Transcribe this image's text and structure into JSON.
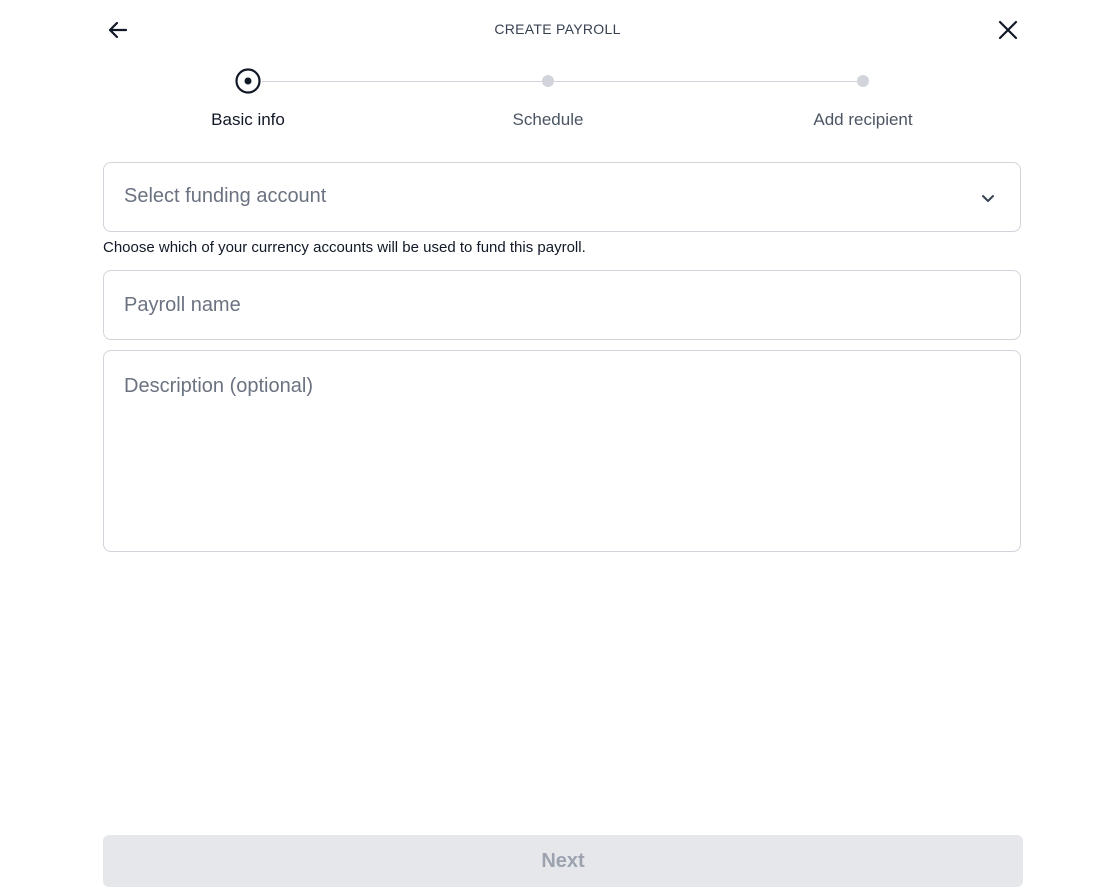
{
  "header": {
    "title": "CREATE PAYROLL",
    "back_icon": "arrow-left-icon",
    "close_icon": "close-icon"
  },
  "stepper": {
    "steps": [
      {
        "label": "Basic info",
        "state": "active"
      },
      {
        "label": "Schedule",
        "state": "pending"
      },
      {
        "label": "Add recipient",
        "state": "pending"
      }
    ]
  },
  "form": {
    "funding_account": {
      "placeholder": "Select funding account",
      "value": "",
      "icon": "chevron-down-icon"
    },
    "funding_help": "Choose which of your currency accounts will be used to fund this payroll.",
    "payroll_name": {
      "placeholder": "Payroll name",
      "value": ""
    },
    "description": {
      "placeholder": "Description (optional)",
      "value": ""
    }
  },
  "footer": {
    "next_label": "Next",
    "next_enabled": false
  },
  "colors": {
    "border": "#d1d5db",
    "placeholder": "#6b7280",
    "disabled_button_bg": "#e5e7eb",
    "disabled_button_text": "#9ca3af"
  }
}
